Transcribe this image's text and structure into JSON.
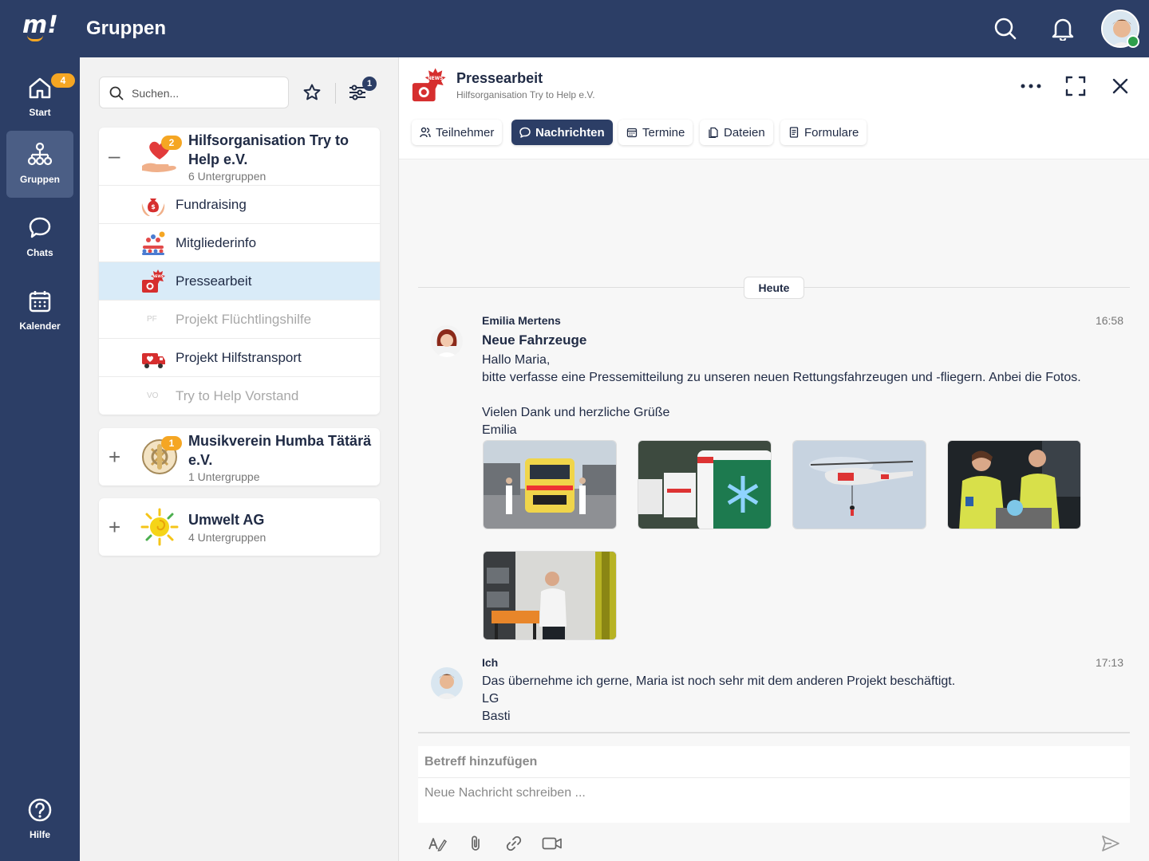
{
  "app": {
    "page_title": "Gruppen",
    "colors": {
      "primary": "#2c3e66",
      "accent": "#f5a623",
      "active_row": "#d9ebf8"
    }
  },
  "leftnav": {
    "items": [
      {
        "label": "Start",
        "icon": "home-icon",
        "badge": "4"
      },
      {
        "label": "Gruppen",
        "icon": "groups-icon"
      },
      {
        "label": "Chats",
        "icon": "chat-icon"
      },
      {
        "label": "Kalender",
        "icon": "calendar-icon"
      },
      {
        "label": "Hilfe",
        "icon": "help-icon"
      }
    ]
  },
  "groups": {
    "search_placeholder": "Suchen...",
    "filter_badge": "1",
    "cards": [
      {
        "name": "Hilfsorganisation Try to Help e.V.",
        "subtitle": "6 Untergruppen",
        "badge": "2",
        "expanded": true,
        "subgroups": [
          {
            "label": "Fundraising"
          },
          {
            "label": "Mitgliederinfo"
          },
          {
            "label": "Pressearbeit",
            "active": true
          },
          {
            "label": "Projekt Flüchtlingshilfe",
            "abbr": "PF",
            "disabled": true
          },
          {
            "label": "Projekt Hilfstransport"
          },
          {
            "label": "Try to Help Vorstand",
            "abbr": "VO",
            "disabled": true
          }
        ]
      },
      {
        "name": "Musikverein Humba Tätärä e.V.",
        "subtitle": "1 Untergruppe",
        "badge": "1"
      },
      {
        "name": "Umwelt AG",
        "subtitle": "4 Untergruppen"
      }
    ]
  },
  "chat": {
    "title": "Pressearbeit",
    "subtitle": "Hilfsorganisation Try to Help e.V.",
    "tabs": [
      "Teilnehmer",
      "Nachrichten",
      "Termine",
      "Dateien",
      "Formulare"
    ],
    "active_tab": "Nachrichten",
    "day_label": "Heute",
    "messages": [
      {
        "author": "Emilia Mertens",
        "time": "16:58",
        "subject": "Neue Fahrzeuge",
        "lines": [
          "Hallo Maria,",
          "bitte verfasse eine Pressemitteilung zu unseren neuen Rettungsfahrzeugen und -fliegern. Anbei die Fotos.",
          "",
          "Vielen Dank und herzliche Grüße",
          "Emilia"
        ]
      },
      {
        "author": "Ich",
        "time": "17:13",
        "lines": [
          "Das übernehme ich gerne, Maria ist noch sehr mit dem anderen Projekt beschäftigt.",
          "LG",
          "Basti"
        ]
      }
    ],
    "compose": {
      "subject_placeholder": "Betreff hinzufügen",
      "body_placeholder": "Neue Nachricht schreiben ..."
    }
  }
}
